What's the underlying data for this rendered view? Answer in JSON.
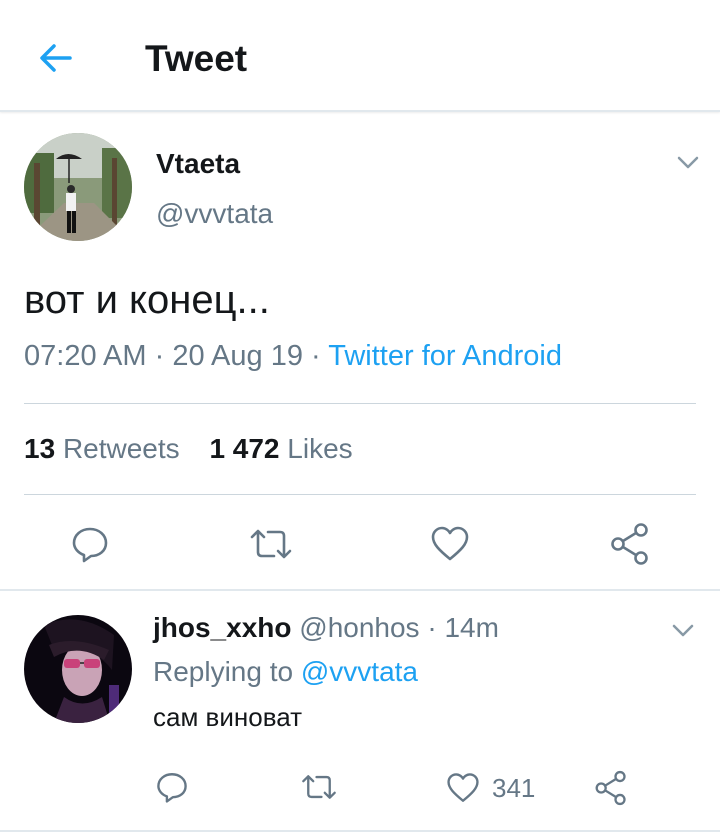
{
  "header": {
    "title": "Tweet",
    "back_icon": "arrow-left-icon",
    "accent": "#1da1f2"
  },
  "tweet": {
    "author_name": "Vtaeta",
    "author_handle": "@vvvtata",
    "text": "вот и конец...",
    "time": "07:20 AM",
    "date": "20 Aug 19",
    "dot": "·",
    "source": "Twitter for Android",
    "retweets_count": "13",
    "retweets_label": "Retweets",
    "likes_count": "1 472",
    "likes_label": "Likes"
  },
  "reply": {
    "author_name": "jhos_xxho",
    "author_handle": "@honhos",
    "dot": "·",
    "age": "14m",
    "replying_prefix": "Replying to",
    "replying_to": "@vvvtata",
    "text": "сам виноват",
    "like_count": "341"
  },
  "colors": {
    "text": "#14171a",
    "secondary": "#657786",
    "link": "#1da1f2",
    "divider": "#e1e8ed"
  }
}
